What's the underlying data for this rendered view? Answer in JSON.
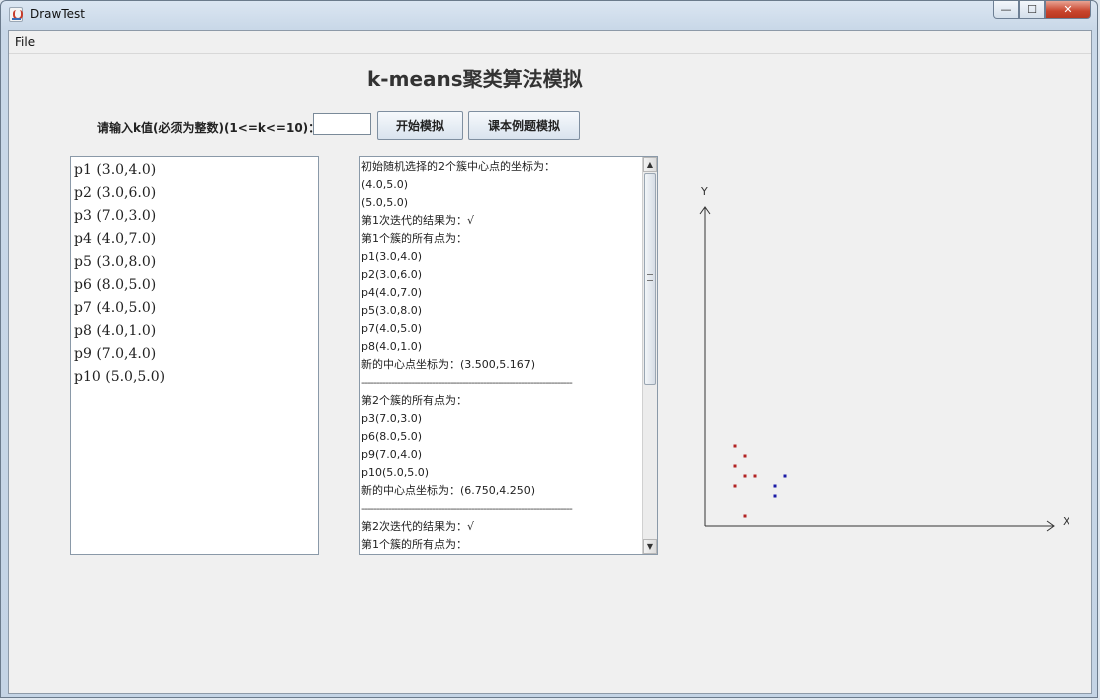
{
  "window": {
    "title": "DrawTest",
    "minimize_glyph": "—",
    "maximize_glyph": "☐",
    "close_glyph": "✕"
  },
  "menu": {
    "file": "File"
  },
  "heading": "k-means聚类算法模拟",
  "controls": {
    "k_label": "请输入k值(必须为整数)(1<=k<=10)：",
    "k_value": "",
    "start_button": "开始模拟",
    "example_button": "课本例题模拟"
  },
  "points": [
    "p1 (3.0,4.0)",
    "p2 (3.0,6.0)",
    "p3 (7.0,3.0)",
    "p4 (4.0,7.0)",
    "p5 (3.0,8.0)",
    "p6 (8.0,5.0)",
    "p7 (4.0,5.0)",
    "p8 (4.0,1.0)",
    "p9 (7.0,4.0)",
    "p10 (5.0,5.0)"
  ],
  "output_lines": [
    "初始随机选择的2个簇中心点的坐标为：",
    "(4.0,5.0)",
    "(5.0,5.0)",
    "第1次迭代的结果为：√",
    "第1个簇的所有点为：",
    "p1(3.0,4.0)",
    "p2(3.0,6.0)",
    "p4(4.0,7.0)",
    "p5(3.0,8.0)",
    "p7(4.0,5.0)",
    "p8(4.0,1.0)",
    "新的中心点坐标为：(3.500,5.167)",
    "-----------------------------------------------------------------------",
    "第2个簇的所有点为：",
    "p3(7.0,3.0)",
    "p6(8.0,5.0)",
    "p9(7.0,4.0)",
    "p10(5.0,5.0)",
    "新的中心点坐标为：(6.750,4.250)",
    "-----------------------------------------------------------------------",
    "第2次迭代的结果为：√",
    "第1个簇的所有点为："
  ],
  "scrollbar": {
    "up_glyph": "▲",
    "down_glyph": "▼"
  },
  "plot": {
    "y_label": "Y",
    "x_label": "X",
    "cluster_colors": [
      "#b22222",
      "#1a1aa6"
    ],
    "points": [
      {
        "name": "p1",
        "x": 3.0,
        "y": 4.0,
        "cluster": 0
      },
      {
        "name": "p2",
        "x": 3.0,
        "y": 6.0,
        "cluster": 0
      },
      {
        "name": "p3",
        "x": 7.0,
        "y": 3.0,
        "cluster": 1
      },
      {
        "name": "p4",
        "x": 4.0,
        "y": 7.0,
        "cluster": 0
      },
      {
        "name": "p5",
        "x": 3.0,
        "y": 8.0,
        "cluster": 0
      },
      {
        "name": "p6",
        "x": 8.0,
        "y": 5.0,
        "cluster": 1
      },
      {
        "name": "p7",
        "x": 4.0,
        "y": 5.0,
        "cluster": 0
      },
      {
        "name": "p8",
        "x": 4.0,
        "y": 1.0,
        "cluster": 0
      },
      {
        "name": "p9",
        "x": 7.0,
        "y": 4.0,
        "cluster": 1
      },
      {
        "name": "p10",
        "x": 5.0,
        "y": 5.0,
        "cluster": 0
      }
    ]
  }
}
